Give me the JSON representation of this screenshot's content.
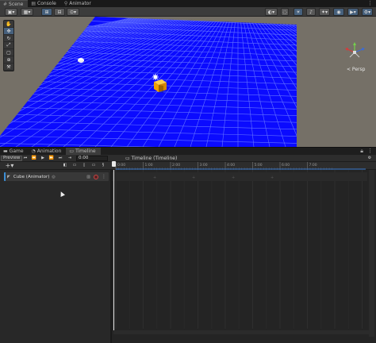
{
  "top_tabs": [
    {
      "icon": "scene-icon",
      "label": "Scene"
    },
    {
      "icon": "console-icon",
      "label": "Console"
    },
    {
      "icon": "animator-icon",
      "label": "Animator"
    }
  ],
  "scene": {
    "gizmo_label": "< Persp",
    "colors": {
      "plane": "#0a0aff",
      "background": "#757067",
      "cube": "#f5a400"
    }
  },
  "timeline_tabs": [
    {
      "icon": "game-icon",
      "label": "Game"
    },
    {
      "icon": "animation-icon",
      "label": "Animation"
    },
    {
      "icon": "timeline-icon",
      "label": "Timeline"
    }
  ],
  "timeline": {
    "preview_label": "Preview",
    "time_value": "0:00",
    "title": "Timeline (Timeline)",
    "add_label": "+",
    "track_label": "Cube (Animator)",
    "ruler_ticks": [
      "0:00",
      "1:00",
      "2:00",
      "3:00",
      "4:00",
      "5:00",
      "6:00",
      "7:00"
    ]
  }
}
